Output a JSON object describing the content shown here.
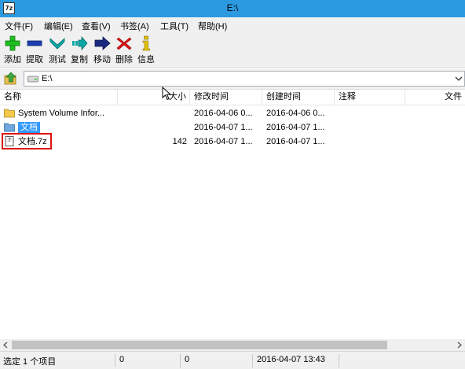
{
  "window": {
    "title": "E:\\",
    "app_icon_text": "7z"
  },
  "menu": [
    "文件(F)",
    "编辑(E)",
    "查看(V)",
    "书签(A)",
    "工具(T)",
    "帮助(H)"
  ],
  "toolbar": [
    {
      "label": "添加",
      "icon": "add-icon",
      "color": "#1fbf1f"
    },
    {
      "label": "提取",
      "icon": "extract-icon",
      "color": "#1a3fb0"
    },
    {
      "label": "测试",
      "icon": "test-icon",
      "color": "#0aa6a6"
    },
    {
      "label": "复制",
      "icon": "copy-icon",
      "color": "#0aa6a6"
    },
    {
      "label": "移动",
      "icon": "move-icon",
      "color": "#1a2a80"
    },
    {
      "label": "删除",
      "icon": "delete-icon",
      "color": "#e01515"
    },
    {
      "label": "信息",
      "icon": "info-icon",
      "color": "#e6c200"
    }
  ],
  "address": {
    "path": "E:\\"
  },
  "columns": [
    "名称",
    "大小",
    "修改时间",
    "创建时间",
    "注释",
    "文件"
  ],
  "files": [
    {
      "name": "System Volume Infor...",
      "size": "",
      "modified": "2016-04-06 0...",
      "created": "2016-04-06 0...",
      "type": "folder"
    },
    {
      "name": "文档",
      "size": "",
      "modified": "2016-04-07 1...",
      "created": "2016-04-07 1...",
      "type": "folder",
      "selected": true
    },
    {
      "name": "文档.7z",
      "size": "142",
      "modified": "2016-04-07 1...",
      "created": "2016-04-07 1...",
      "type": "archive",
      "highlighted": true
    }
  ],
  "status": {
    "selection": "选定 1 个项目",
    "size": "0",
    "packed": "0",
    "datetime": "2016-04-07 13:43"
  },
  "colors": {
    "titlebar": "#2b9ae0",
    "selection": "#3399ff",
    "highlight_box": "#e01010"
  }
}
